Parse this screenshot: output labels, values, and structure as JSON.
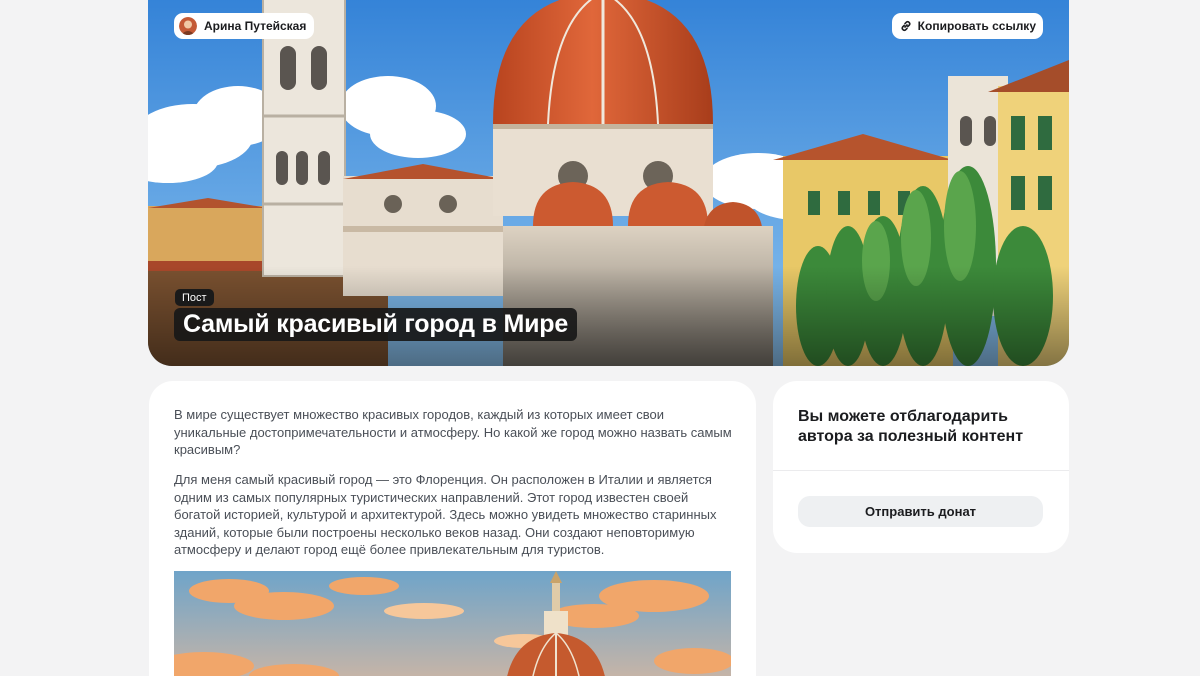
{
  "post": {
    "author_name": "Арина Путейская",
    "copy_link_label": "Копировать ссылку",
    "badge": "Пост",
    "title": "Самый красивый город в Мире"
  },
  "article": {
    "paragraphs": [
      "В мире существует множество красивых городов, каждый из которых имеет свои уникальные достопримечательности и атмосферу. Но какой же город можно назвать самым красивым?",
      "Для меня самый красивый город — это Флоренция. Он расположен в Италии и является одним из самых популярных туристических направлений. Этот город известен своей богатой историей, культурой и архитектурой. Здесь можно увидеть множество старинных зданий, которые были построены несколько веков назад. Они создают неповторимую атмосферу и делают город ещё более привлекательным для туристов."
    ]
  },
  "donate": {
    "title": "Вы можете отблагодарить автора за полезный контент",
    "button_label": "Отправить донат"
  },
  "images": {
    "hero": "florence-cathedral-illustration",
    "article": "florence-dome-sunset-illustration"
  },
  "colors": {
    "background": "#f3f3f4",
    "card": "#ffffff",
    "text": "#1b1c1f",
    "body_text": "#4a4f57",
    "button": "#eef0f2",
    "dome": "#d4572c",
    "sky": "#3d8fdc"
  }
}
